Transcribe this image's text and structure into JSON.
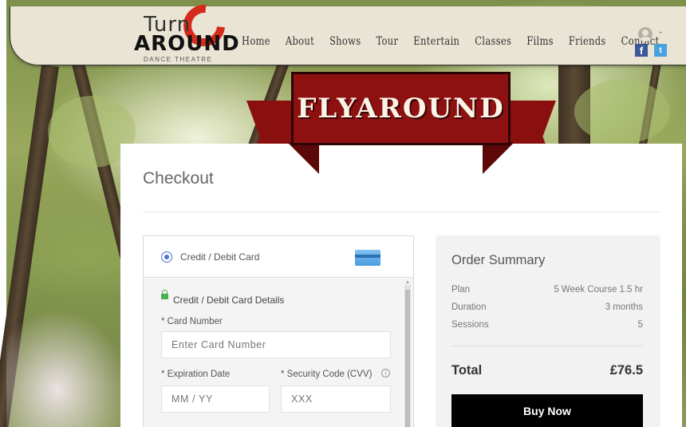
{
  "brand": {
    "logo_top": "Turn",
    "logo_main": "AROUND",
    "logo_sub": "DANCE THEATRE"
  },
  "nav": {
    "items": [
      "Home",
      "About",
      "Shows",
      "Tour",
      "Entertain",
      "Classes",
      "Films",
      "Friends",
      "Contact"
    ]
  },
  "social": {
    "facebook": "f",
    "twitter": "t"
  },
  "banner": {
    "text": "FLYAROUND"
  },
  "checkout": {
    "title": "Checkout",
    "payment": {
      "method_label": "Credit / Debit Card",
      "details_label": "Credit / Debit Card Details",
      "card_number_label": "* Card Number",
      "card_number_placeholder": "Enter Card Number",
      "expiration_label": "* Expiration Date",
      "expiration_placeholder": "MM / YY",
      "cvv_label": "* Security Code (CVV)",
      "cvv_placeholder": "XXX",
      "info_glyph": "i"
    },
    "summary": {
      "title": "Order Summary",
      "rows": [
        {
          "label": "Plan",
          "value": "5 Week Course 1.5 hr"
        },
        {
          "label": "Duration",
          "value": "3 months"
        },
        {
          "label": "Sessions",
          "value": "5"
        }
      ],
      "total_label": "Total",
      "total_value": "£76.5",
      "buy_label": "Buy Now"
    }
  },
  "colors": {
    "header_bg": "#e9e4d4",
    "banner_red": "#8d1111",
    "accent_blue": "#4a74d4",
    "buy_button": "#000000"
  }
}
